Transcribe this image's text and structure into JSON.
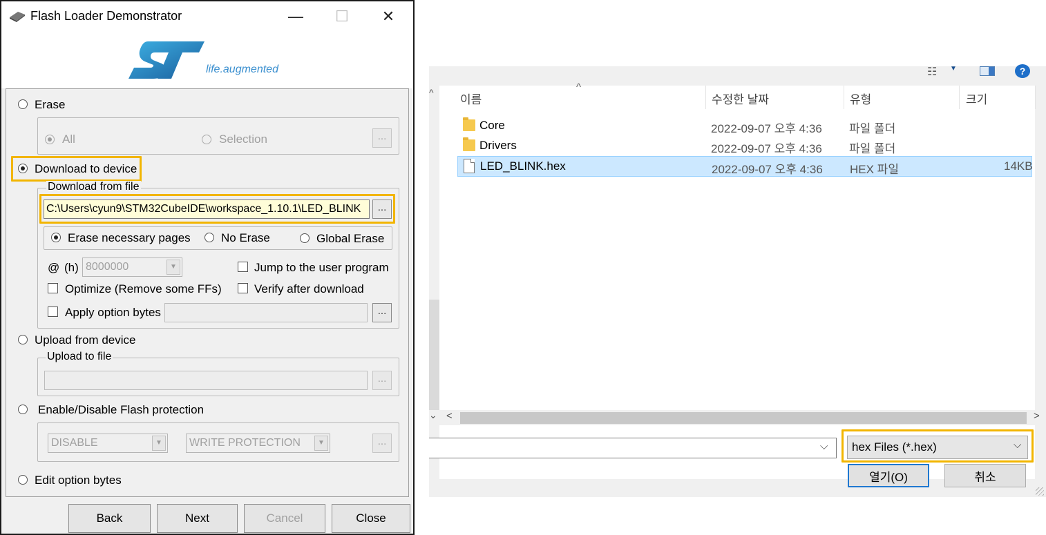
{
  "flash_loader": {
    "title": "Flash Loader Demonstrator",
    "logo_text": "life.augmented",
    "options": {
      "erase": "Erase",
      "erase_all": "All",
      "erase_selection": "Selection",
      "download": "Download to device",
      "download_from_file": "Download from file",
      "file_path": "C:\\Users\\cyun9\\STM32CubeIDE\\workspace_1.10.1\\LED_BLINK",
      "erase_necessary": "Erase necessary pages",
      "no_erase": "No Erase",
      "global_erase": "Global Erase",
      "at": "@",
      "hex_unit": "(h)",
      "address": "8000000",
      "jump_user": "Jump to the user program",
      "optimize": "Optimize (Remove some FFs)",
      "verify": "Verify after download",
      "apply_option_bytes": "Apply option bytes",
      "upload": "Upload from device",
      "upload_to_file": "Upload to file",
      "flash_protection": "Enable/Disable Flash protection",
      "protection_state": "DISABLE",
      "protection_type": "WRITE PROTECTION",
      "edit_option_bytes": "Edit option bytes",
      "browse": "..."
    },
    "buttons": {
      "back": "Back",
      "next": "Next",
      "cancel": "Cancel",
      "close": "Close"
    },
    "caption": {
      "minimize": "—",
      "maximize": "☐",
      "close": "✕"
    }
  },
  "file_dialog": {
    "columns": {
      "name": "이름",
      "date": "수정한 날짜",
      "type": "유형",
      "size": "크기"
    },
    "files": [
      {
        "name": "Core",
        "date": "2022-09-07 오후 4:36",
        "type": "파일 폴더",
        "size": "",
        "kind": "folder"
      },
      {
        "name": "Drivers",
        "date": "2022-09-07 오후 4:36",
        "type": "파일 폴더",
        "size": "",
        "kind": "folder"
      },
      {
        "name": "LED_BLINK.hex",
        "date": "2022-09-07 오후 4:36",
        "type": "HEX 파일",
        "size": "14KB",
        "kind": "file"
      }
    ],
    "filter": "hex Files (*.hex)",
    "open_button": "열기(O)",
    "cancel_button": "취소",
    "help": "?",
    "view_icon": "☷",
    "arrows": {
      "dropdown": "⌵",
      "sort": "^",
      "left": "<",
      "right": ">",
      "up": "^",
      "down": "⌄",
      "caret": "▼"
    }
  }
}
